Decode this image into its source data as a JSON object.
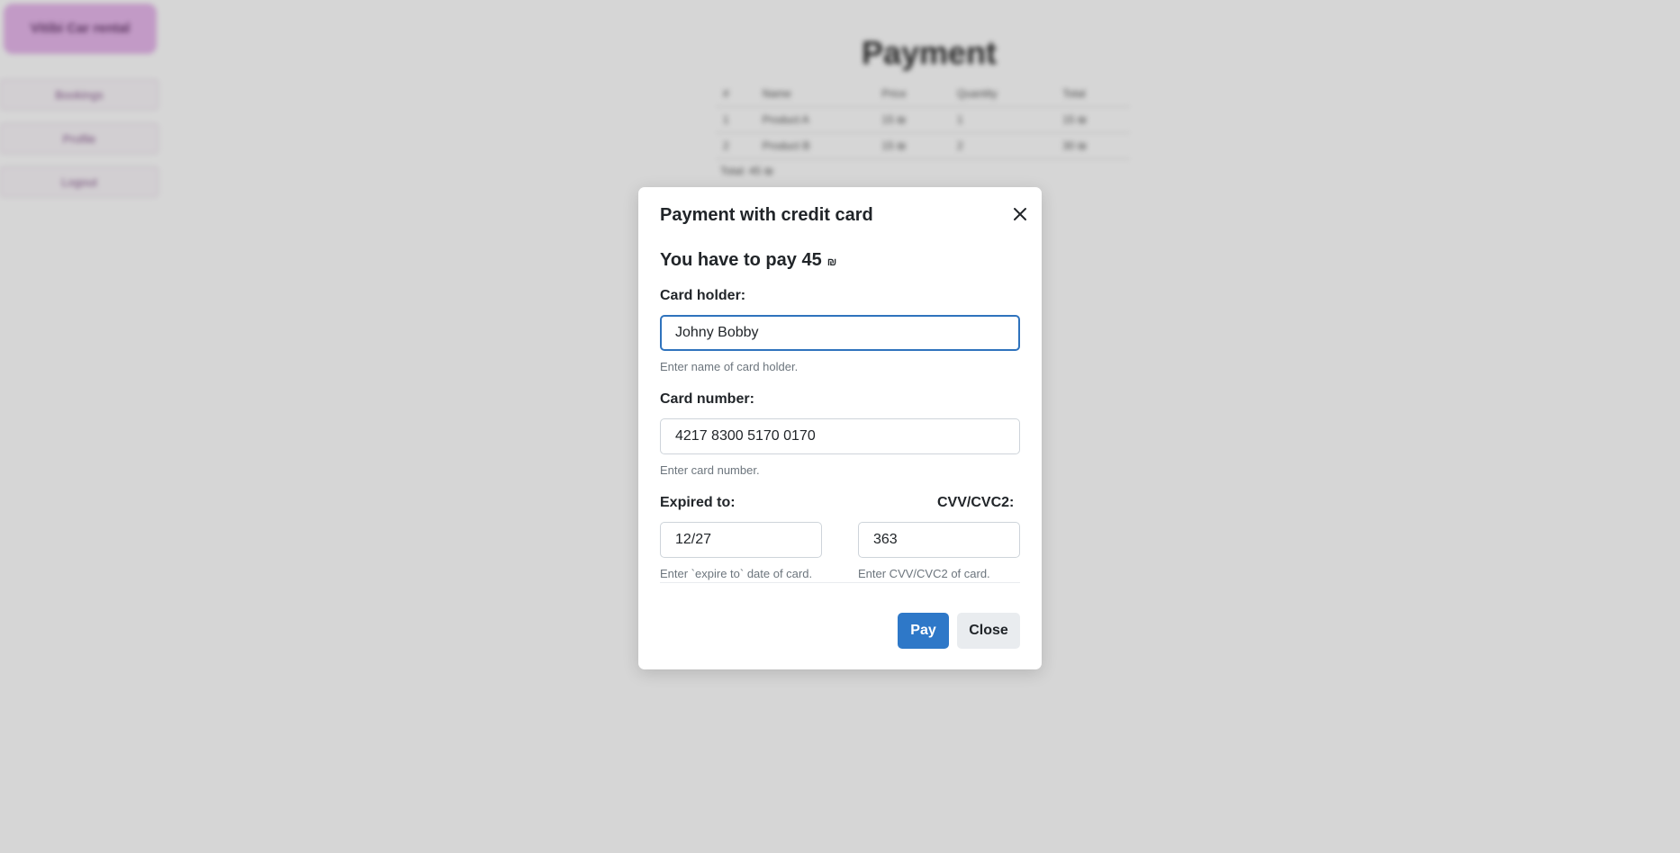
{
  "background": {
    "logo_text": "Vitibi Car rental",
    "sidebar_items": [
      "Bookings",
      "Profile",
      "Logout"
    ],
    "page_title": "Payment",
    "table_headers": [
      "#",
      "Name",
      "Price",
      "Quantity",
      "Total"
    ],
    "table_rows": [
      [
        "1",
        "Product A",
        "15 ₪",
        "1",
        "15 ₪"
      ],
      [
        "2",
        "Product B",
        "15 ₪",
        "2",
        "30 ₪"
      ]
    ],
    "total_text": "Total: 45 ₪"
  },
  "modal": {
    "title": "Payment with credit card",
    "pay_heading": "You have to pay 45",
    "currency_symbol": "₪",
    "card_holder": {
      "label": "Card holder:",
      "value": "Johny Bobby",
      "help": "Enter name of card holder."
    },
    "card_number": {
      "label": "Card number:",
      "value": "4217 8300 5170 0170",
      "help": "Enter card number."
    },
    "expiry": {
      "label": "Expired to:",
      "value": "12/27",
      "help": "Enter `expire to` date of card."
    },
    "cvv": {
      "label": "CVV/CVC2:",
      "value": "363",
      "help": "Enter CVV/CVC2 of card."
    },
    "pay_button": "Pay",
    "close_button": "Close"
  },
  "colors": {
    "primary": "#2e78c8",
    "focus_border": "#2f73bd",
    "secondary_button": "#e9ecef",
    "logo_bg": "#e7b8ec"
  }
}
